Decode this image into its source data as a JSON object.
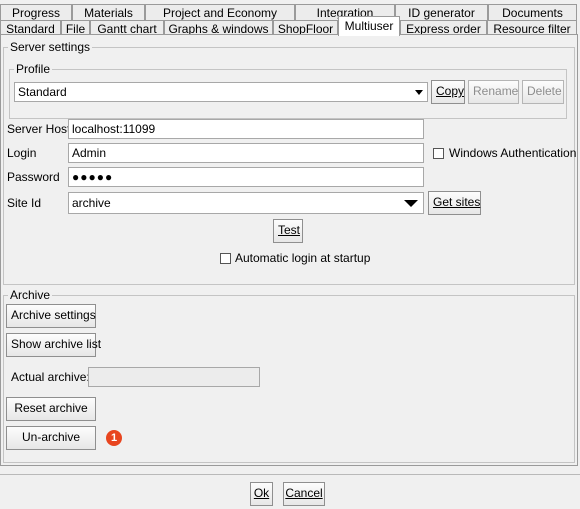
{
  "tabs_row1": [
    "Progress",
    "Materials",
    "Project and Economy",
    "Integration",
    "ID generator",
    "Documents"
  ],
  "tabs_row2": [
    "Standard",
    "File",
    "Gantt chart",
    "Graphs & windows",
    "ShopFloor",
    "Multiuser",
    "Express order",
    "Resource filter"
  ],
  "active_tab": "Multiuser",
  "server_settings": {
    "title": "Server settings",
    "profile": {
      "title": "Profile",
      "selected": "Standard",
      "copy_label": "Copy",
      "rename_label": "Rename",
      "delete_label": "Delete"
    },
    "server_host_label": "Server Host",
    "server_host_value": "localhost:11099",
    "login_label": "Login",
    "login_value": "Admin",
    "windows_auth_label": "Windows Authentication",
    "windows_auth_checked": false,
    "password_label": "Password",
    "password_value": "●●●●●",
    "site_id_label": "Site Id",
    "site_id_value": "archive",
    "get_sites_label": "Get sites",
    "test_label": "Test",
    "auto_login_label": "Automatic login at startup",
    "auto_login_checked": false
  },
  "archive": {
    "title": "Archive",
    "archive_settings_label": "Archive settings",
    "show_archive_list_label": "Show archive list",
    "actual_archive_label": "Actual archive:",
    "actual_archive_value": "",
    "reset_archive_label": "Reset archive",
    "unarchive_label": "Un-archive",
    "badge": "1"
  },
  "footer": {
    "ok_label": "Ok",
    "cancel_label": "Cancel"
  }
}
